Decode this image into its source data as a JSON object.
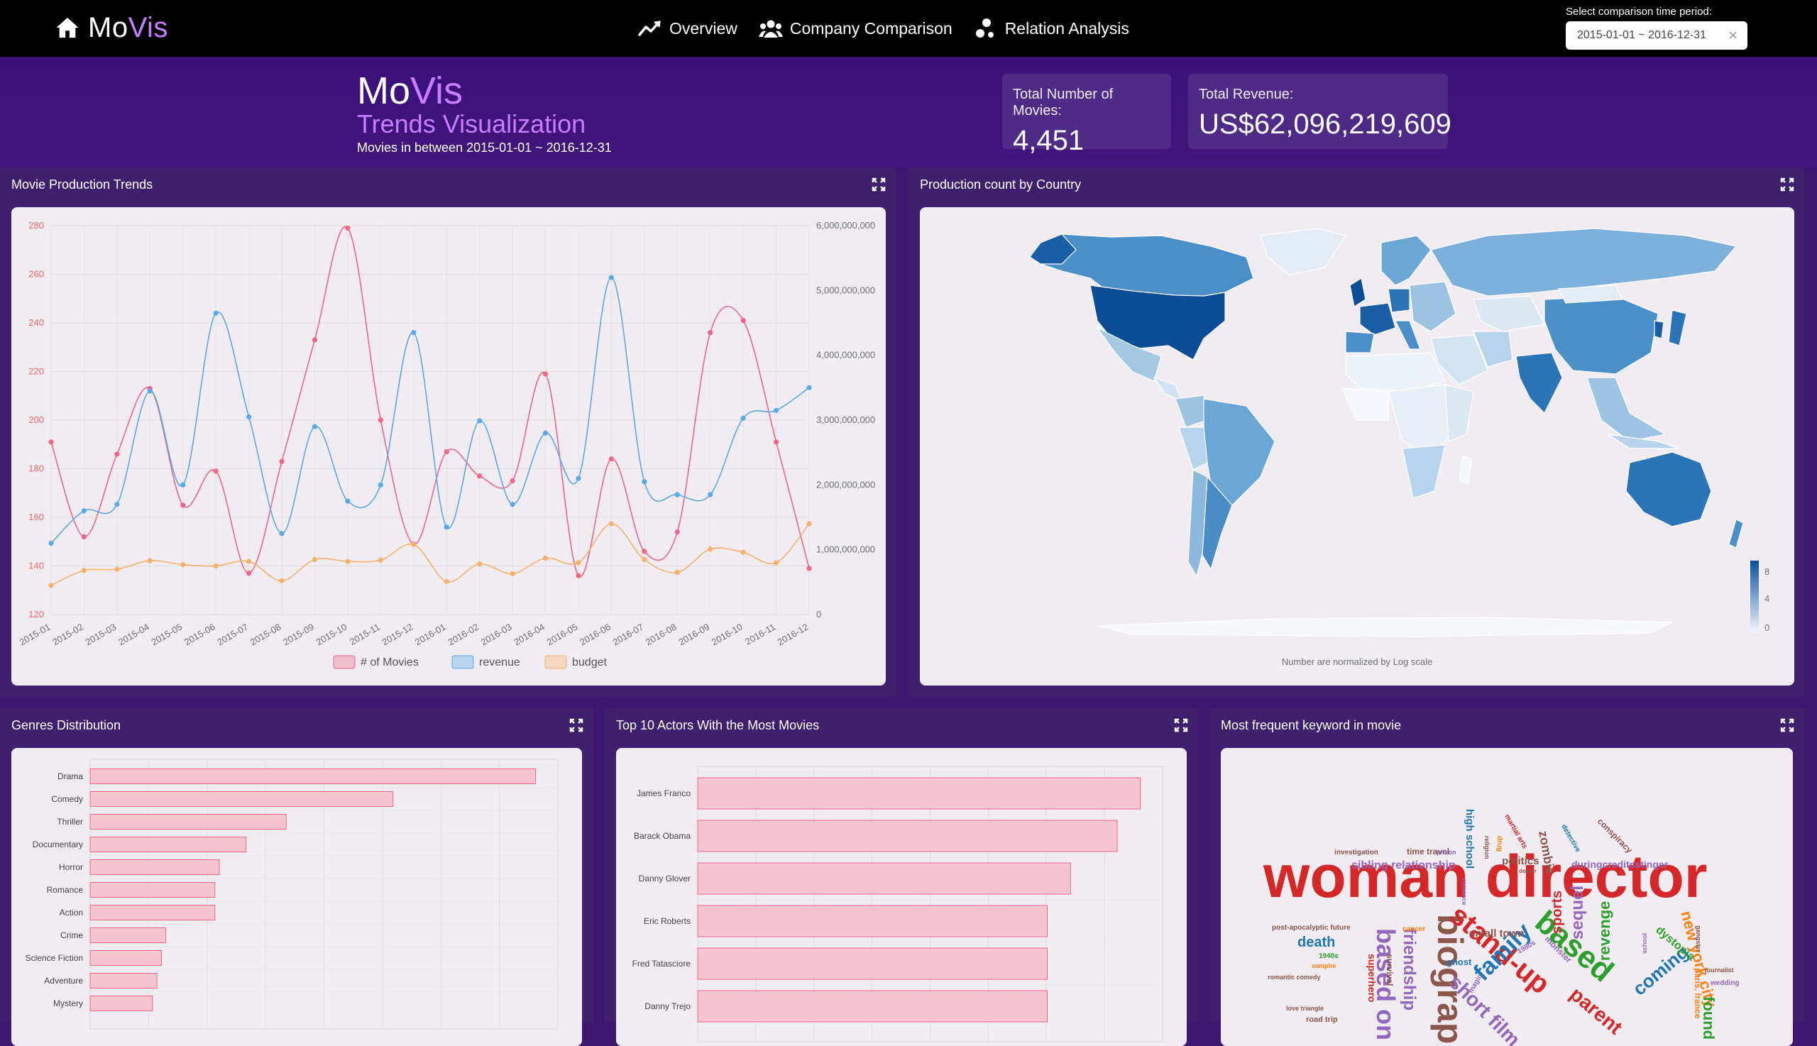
{
  "brand": {
    "mo": "Mo",
    "vis": "Vis"
  },
  "nav": [
    {
      "label": "Overview",
      "icon": "trend-line-icon"
    },
    {
      "label": "Company Comparison",
      "icon": "users-icon"
    },
    {
      "label": "Relation Analysis",
      "icon": "network-nodes-icon"
    }
  ],
  "period": {
    "label": "Select comparison time period:",
    "value": "2015-01-01 ~ 2016-12-31"
  },
  "hero": {
    "mo": "Mo",
    "vis": "Vis",
    "subtitle": "Trends Visualization",
    "range": "Movies in between 2015-01-01 ~ 2016-12-31"
  },
  "stats": {
    "movies_label": "Total Number of Movies:",
    "movies_value": "4,451",
    "revenue_label": "Total Revenue:",
    "revenue_value": "US$62,096,219,609"
  },
  "panels": {
    "trends": "Movie Production Trends",
    "country": "Production count by Country",
    "genres": "Genres Distribution",
    "actors": "Top 10 Actors With the Most Movies",
    "keywords": "Most frequent keyword in movie"
  },
  "map": {
    "note": "Number are normalized by Log scale",
    "legend": [
      "8",
      "4",
      "0"
    ],
    "color_high": "#08519c",
    "color_low": "#eff3ff"
  },
  "chart_data": [
    {
      "type": "line",
      "categories": [
        "2015-01",
        "2015-02",
        "2015-03",
        "2015-04",
        "2015-05",
        "2015-06",
        "2015-07",
        "2015-08",
        "2015-09",
        "2015-10",
        "2015-11",
        "2015-12",
        "2016-01",
        "2016-02",
        "2016-03",
        "2016-04",
        "2016-05",
        "2016-06",
        "2016-07",
        "2016-08",
        "2016-09",
        "2016-10",
        "2016-11",
        "2016-12"
      ],
      "left_ticks": [
        "280",
        "260",
        "240",
        "220",
        "200",
        "180",
        "160",
        "140",
        "120"
      ],
      "right_ticks": [
        "6,000,000,000",
        "5,000,000,000",
        "4,000,000,000",
        "3,000,000,000",
        "2,000,000,000",
        "1,000,000,000",
        "0"
      ],
      "ylim": [
        120,
        280
      ],
      "y2lim": [
        0,
        6000000000
      ],
      "series": [
        {
          "name": "# of Movies",
          "axis": "left",
          "color": "#ee6688",
          "values": [
            191,
            152,
            186,
            213,
            165,
            179,
            137,
            183,
            233,
            279,
            200,
            149,
            187,
            177,
            175,
            219,
            136,
            184,
            146,
            154,
            236,
            241,
            191,
            139
          ]
        },
        {
          "name": "revenue",
          "axis": "right",
          "color": "#5aaae6",
          "values": [
            1100000000,
            1600000000,
            1700000000,
            3450000000,
            2000000000,
            4650000000,
            3050000000,
            1250000000,
            2900000000,
            1750000000,
            2000000000,
            4350000000,
            1350000000,
            2990000000,
            1700000000,
            2800000000,
            2100000000,
            5200000000,
            2050000000,
            1850000000,
            1850000000,
            3030000000,
            3150000000,
            3500000000
          ]
        },
        {
          "name": "budget",
          "axis": "right",
          "color": "#f5b26b",
          "values": [
            450000000,
            680000000,
            700000000,
            830000000,
            770000000,
            750000000,
            820000000,
            520000000,
            850000000,
            820000000,
            840000000,
            1080000000,
            510000000,
            780000000,
            630000000,
            870000000,
            800000000,
            1400000000,
            850000000,
            650000000,
            1010000000,
            960000000,
            800000000,
            1400000000
          ]
        }
      ]
    },
    {
      "type": "bar",
      "title": "Genres Distribution",
      "categories": [
        "Drama",
        "Comedy",
        "Thriller",
        "Documentary",
        "Horror",
        "Romance",
        "Action",
        "Crime",
        "Science Fiction",
        "Adventure",
        "Mystery"
      ],
      "values": [
        100,
        68,
        44,
        35,
        29,
        28,
        28,
        17,
        16,
        15,
        14
      ]
    },
    {
      "type": "bar",
      "title": "Top 10 Actors With the Most Movies",
      "categories": [
        "James Franco",
        "Barack Obama",
        "Danny Glover",
        "Eric Roberts",
        "Fred Tatasciore",
        "Danny Trejo"
      ],
      "values": [
        19,
        18,
        16,
        15,
        15,
        15
      ]
    }
  ],
  "keywords": [
    {
      "text": "woman director",
      "color": "#d62728"
    },
    {
      "text": "biography",
      "color": "#8c564b"
    },
    {
      "text": "based on",
      "color": "#9467bd"
    },
    {
      "text": "stand-up",
      "color": "#d62728"
    },
    {
      "text": "based",
      "color": "#2ca02c"
    },
    {
      "text": "family",
      "color": "#1f77b4"
    },
    {
      "text": "short film",
      "color": "#9467bd"
    },
    {
      "text": "friendship",
      "color": "#9467bd"
    },
    {
      "text": "sequel",
      "color": "#9467bd"
    },
    {
      "text": "sports",
      "color": "#d62728"
    },
    {
      "text": "revenge",
      "color": "#2ca02c"
    },
    {
      "text": "new york city",
      "color": "#ff7f0e"
    },
    {
      "text": "parent",
      "color": "#d62728"
    },
    {
      "text": "coming",
      "color": "#1f77b4"
    },
    {
      "text": "death",
      "color": "#1f77b4"
    },
    {
      "text": "small town",
      "color": "#8c564b"
    },
    {
      "text": "sibling relationship",
      "color": "#9467bd"
    },
    {
      "text": "duringcreditsstinger",
      "color": "#9467bd"
    },
    {
      "text": "politics",
      "color": "#8c564b"
    },
    {
      "text": "zombie",
      "color": "#8c564b"
    },
    {
      "text": "high school",
      "color": "#1f77b4"
    },
    {
      "text": "time travel",
      "color": "#8c564b"
    },
    {
      "text": "dystopia",
      "color": "#2ca02c"
    },
    {
      "text": "superhero",
      "color": "#d62728"
    },
    {
      "text": "survival",
      "color": "#8c564b"
    },
    {
      "text": "monster",
      "color": "#9467bd"
    },
    {
      "text": "conspiracy",
      "color": "#8c564b"
    },
    {
      "text": "investigation",
      "color": "#8c564b"
    },
    {
      "text": "post-apocalyptic future",
      "color": "#8c564b"
    },
    {
      "text": "ghost",
      "color": "#1f77b4"
    },
    {
      "text": "1940s",
      "color": "#2ca02c"
    },
    {
      "text": "vampire",
      "color": "#ff7f0e"
    },
    {
      "text": "romantic comedy",
      "color": "#8c564b"
    },
    {
      "text": "love triangle",
      "color": "#8c564b"
    },
    {
      "text": "road trip",
      "color": "#8c564b"
    },
    {
      "text": "cancer",
      "color": "#ff7f0e"
    },
    {
      "text": "journalist",
      "color": "#8c564b"
    },
    {
      "text": "wedding",
      "color": "#9467bd"
    },
    {
      "text": "gangster",
      "color": "#8c564b"
    },
    {
      "text": "paris, france",
      "color": "#ff7f0e"
    },
    {
      "text": "found",
      "color": "#2ca02c"
    },
    {
      "text": "prison",
      "color": "#9467bd"
    },
    {
      "text": "martial arts",
      "color": "#d62728"
    },
    {
      "text": "religion",
      "color": "#8c564b"
    },
    {
      "text": "drug",
      "color": "#ff7f0e"
    },
    {
      "text": "magic",
      "color": "#9467bd"
    },
    {
      "text": "detective",
      "color": "#1f77b4"
    },
    {
      "text": "school",
      "color": "#9467bd"
    },
    {
      "text": "doctor",
      "color": "#8c564b"
    },
    {
      "text": "romance",
      "color": "#9467bd"
    },
    {
      "text": "1980s",
      "color": "#9467bd"
    }
  ]
}
